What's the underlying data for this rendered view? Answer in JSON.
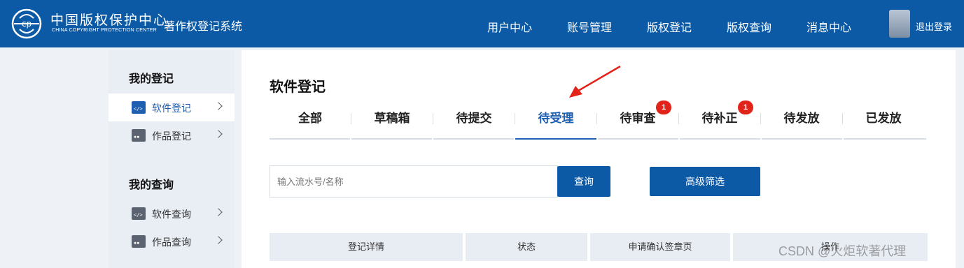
{
  "header": {
    "org_name_cn": "中国版权保护中心",
    "org_name_en": "CHINA COPYRIGHT PROTECTION CENTER",
    "system_name": "著作权登记系统",
    "nav": [
      "用户中心",
      "账号管理",
      "版权登记",
      "版权查询",
      "消息中心"
    ],
    "logout_label": "退出登录"
  },
  "sidebar": {
    "sections": [
      {
        "title": "我的登记",
        "items": [
          {
            "label": "软件登记",
            "active": true
          },
          {
            "label": "作品登记",
            "active": false
          }
        ]
      },
      {
        "title": "我的查询",
        "items": [
          {
            "label": "软件查询",
            "active": false
          },
          {
            "label": "作品查询",
            "active": false
          }
        ]
      }
    ]
  },
  "main": {
    "title": "软件登记",
    "tabs": [
      {
        "label": "全部",
        "badge": ""
      },
      {
        "label": "草稿箱",
        "badge": ""
      },
      {
        "label": "待提交",
        "badge": ""
      },
      {
        "label": "待受理",
        "badge": "",
        "active": true
      },
      {
        "label": "待审查",
        "badge": "1"
      },
      {
        "label": "待补正",
        "badge": "1"
      },
      {
        "label": "待发放",
        "badge": ""
      },
      {
        "label": "已发放",
        "badge": ""
      }
    ],
    "search": {
      "placeholder": "输入流水号/名称",
      "value": "",
      "button_label": "查询"
    },
    "filter_button_label": "高级筛选",
    "table_headers": [
      "登记详情",
      "状态",
      "申请确认签章页",
      "操作"
    ]
  },
  "watermark": "CSDN @火炬软著代理",
  "colors": {
    "brand": "#0c5aa6",
    "accent": "#1f5fb2",
    "badge": "#e2231a",
    "arrow": "#e2231a"
  }
}
